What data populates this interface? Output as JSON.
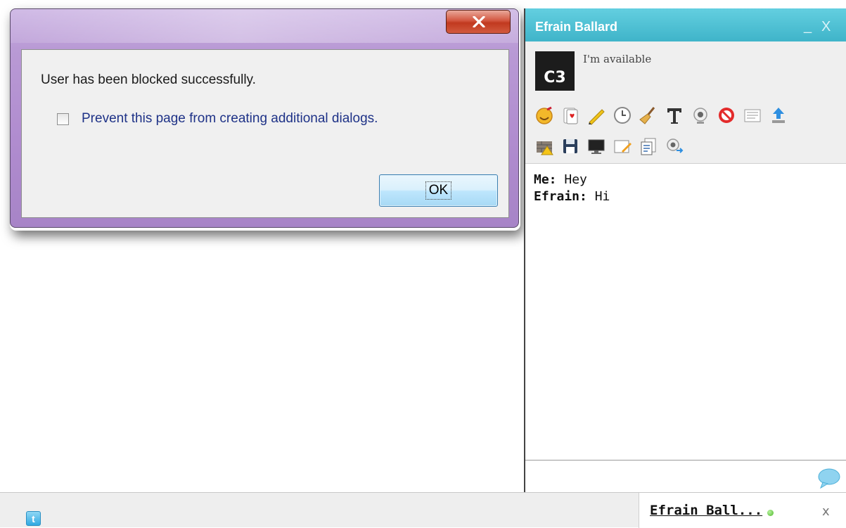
{
  "dialog": {
    "close_glyph": "X",
    "message": "User has been blocked successfully.",
    "checkbox_label": "Prevent this page from creating additional dialogs.",
    "checkbox_checked": false,
    "ok_label": "OK"
  },
  "chat": {
    "title": "Efrain Ballard",
    "minimize_glyph": "_",
    "close_glyph": "X",
    "avatar_text": "C3",
    "status": "I'm available",
    "toolbar_row1": [
      "smiley-icon",
      "card-game-icon",
      "pencil-icon",
      "clock-icon",
      "broom-icon",
      "text-format-icon",
      "webcam-icon",
      "block-icon",
      "chat-log-icon",
      "upload-icon"
    ],
    "toolbar_row2": [
      "report-wall-icon",
      "save-icon",
      "screen-share-icon",
      "whiteboard-icon",
      "transcript-icon",
      "video-call-icon"
    ],
    "messages": [
      {
        "sender": "Me:",
        "text": "Hey"
      },
      {
        "sender": "Efrain:",
        "text": "Hi"
      }
    ]
  },
  "bottom_bar": {
    "twitter_glyph": "t",
    "chat_tab_name": "Efrain Ball...",
    "chat_tab_close": "x",
    "status_color": "#4fb82a"
  },
  "colors": {
    "chat_header": "#3fb4c9",
    "dialog_frame": "#b08ccf",
    "close_button": "#c1391f",
    "ok_button": "#bee6fd"
  }
}
